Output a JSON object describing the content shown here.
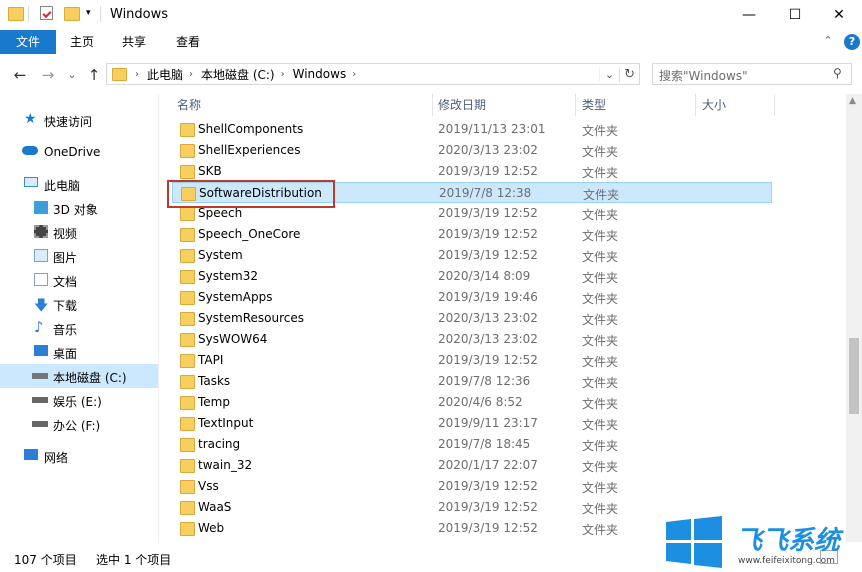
{
  "window": {
    "title": "Windows",
    "min": "—",
    "max": "☐",
    "close": "✕",
    "help": "?",
    "collapse": "⌃"
  },
  "ribbon": {
    "tabs": [
      "文件",
      "主页",
      "共享",
      "查看"
    ]
  },
  "address": {
    "crumbs": [
      "此电脑",
      "本地磁盘 (C:)",
      "Windows"
    ],
    "dropdown": "⌄",
    "refresh": "↻"
  },
  "search": {
    "placeholder": "搜索\"Windows\""
  },
  "nav": {
    "back": "←",
    "forward": "→",
    "recent": "⌄",
    "up": "↑",
    "items": [
      {
        "label": "快速访问",
        "icon": "star-icon",
        "color": "#1979ca"
      },
      {
        "label": "OneDrive",
        "icon": "cloud-icon",
        "color": "#1979ca"
      },
      {
        "label": "此电脑",
        "icon": "computer-icon",
        "color": "#3a8ad8"
      },
      {
        "label": "3D 对象",
        "icon": "cube-icon",
        "color": "#39a0d8"
      },
      {
        "label": "视频",
        "icon": "video-icon",
        "color": "#444444"
      },
      {
        "label": "图片",
        "icon": "picture-icon",
        "color": "#6fa7d6"
      },
      {
        "label": "文档",
        "icon": "document-icon",
        "color": "#8aa0b8"
      },
      {
        "label": "下载",
        "icon": "download-icon",
        "color": "#2d7ed8"
      },
      {
        "label": "音乐",
        "icon": "music-icon",
        "color": "#2d7ed8"
      },
      {
        "label": "桌面",
        "icon": "desktop-icon",
        "color": "#2d7ed8"
      },
      {
        "label": "本地磁盘 (C:)",
        "icon": "drive-c-icon",
        "color": "#555555"
      },
      {
        "label": "娱乐 (E:)",
        "icon": "drive-icon",
        "color": "#666666"
      },
      {
        "label": "办公 (F:)",
        "icon": "drive-icon",
        "color": "#666666"
      },
      {
        "label": "网络",
        "icon": "network-icon",
        "color": "#2d7ed8"
      }
    ]
  },
  "columns": {
    "name": "名称",
    "date": "修改日期",
    "type": "类型",
    "size": "大小"
  },
  "files": [
    {
      "name": "ShellComponents",
      "date": "2019/11/13 23:01",
      "type": "文件夹"
    },
    {
      "name": "ShellExperiences",
      "date": "2020/3/13 23:02",
      "type": "文件夹"
    },
    {
      "name": "SKB",
      "date": "2019/3/19 12:52",
      "type": "文件夹"
    },
    {
      "name": "SoftwareDistribution",
      "date": "2019/7/8 12:38",
      "type": "文件夹"
    },
    {
      "name": "Speech",
      "date": "2019/3/19 12:52",
      "type": "文件夹"
    },
    {
      "name": "Speech_OneCore",
      "date": "2019/3/19 12:52",
      "type": "文件夹"
    },
    {
      "name": "System",
      "date": "2019/3/19 12:52",
      "type": "文件夹"
    },
    {
      "name": "System32",
      "date": "2020/3/14 8:09",
      "type": "文件夹"
    },
    {
      "name": "SystemApps",
      "date": "2019/3/19 19:46",
      "type": "文件夹"
    },
    {
      "name": "SystemResources",
      "date": "2020/3/13 23:02",
      "type": "文件夹"
    },
    {
      "name": "SysWOW64",
      "date": "2020/3/13 23:02",
      "type": "文件夹"
    },
    {
      "name": "TAPI",
      "date": "2019/3/19 12:52",
      "type": "文件夹"
    },
    {
      "name": "Tasks",
      "date": "2019/7/8 12:36",
      "type": "文件夹"
    },
    {
      "name": "Temp",
      "date": "2020/4/6 8:52",
      "type": "文件夹"
    },
    {
      "name": "TextInput",
      "date": "2019/9/11 23:17",
      "type": "文件夹"
    },
    {
      "name": "tracing",
      "date": "2019/7/8 18:45",
      "type": "文件夹"
    },
    {
      "name": "twain_32",
      "date": "2020/1/17 22:07",
      "type": "文件夹"
    },
    {
      "name": "Vss",
      "date": "2019/3/19 12:52",
      "type": "文件夹"
    },
    {
      "name": "WaaS",
      "date": "2019/3/19 12:52",
      "type": "文件夹"
    },
    {
      "name": "Web",
      "date": "2019/3/19 12:52",
      "type": "文件夹"
    }
  ],
  "selected_file": "SoftwareDistribution",
  "status": {
    "count": "107 个项目",
    "selection": "选中 1 个项目"
  },
  "watermark": {
    "brand": "飞飞系统",
    "url": "www.feifeixitong.com"
  },
  "colors": {
    "accent": "#1979ca",
    "selection": "#cce8ff",
    "highlight_box": "#c0392b",
    "folder": "#f6cf5f"
  }
}
